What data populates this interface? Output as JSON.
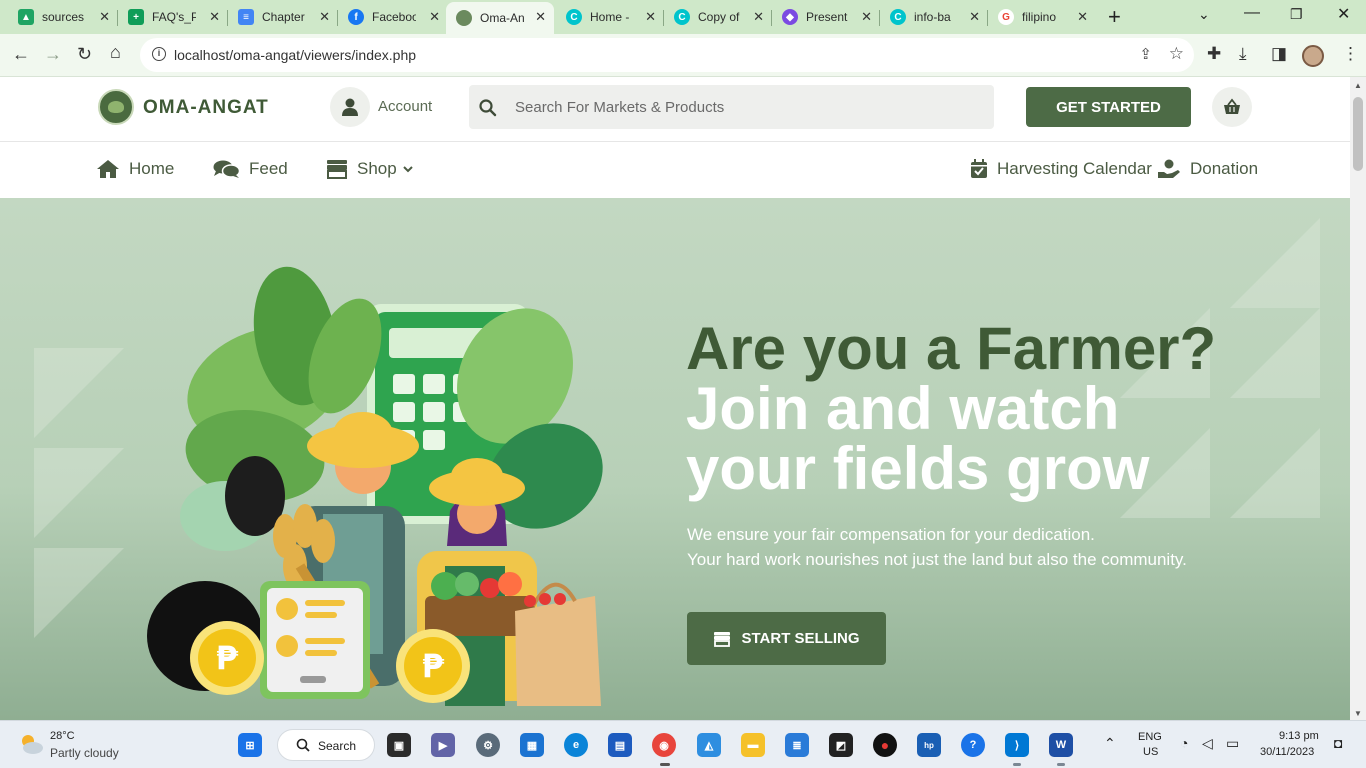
{
  "browser": {
    "tabs": [
      {
        "title": "sources",
        "icon": "google-drive-icon",
        "color": "#1fa463"
      },
      {
        "title": "FAQ's_P",
        "icon": "google-sheets-icon",
        "color": "#0f9d58"
      },
      {
        "title": "Chapter",
        "icon": "google-docs-icon",
        "color": "#4285f4"
      },
      {
        "title": "Facebook",
        "icon": "facebook-icon",
        "color": "#1877f2"
      },
      {
        "title": "Oma-An",
        "icon": "oma-angat-icon",
        "color": "#6b8a5e"
      },
      {
        "title": "Home -",
        "icon": "canva-icon",
        "color": "#00c4cc"
      },
      {
        "title": "Copy of",
        "icon": "canva-icon",
        "color": "#00c4cc"
      },
      {
        "title": "Present",
        "icon": "presentation-icon",
        "color": "#7b4ae2"
      },
      {
        "title": "info-ba",
        "icon": "canva-icon",
        "color": "#00c4cc"
      },
      {
        "title": "filipino",
        "icon": "google-icon",
        "color": "#ea4335"
      }
    ],
    "url": "localhost/oma-angat/viewers/index.php"
  },
  "header": {
    "brand": "OMA-ANGAT",
    "account_label": "Account",
    "search_placeholder": "Search For Markets & Products",
    "get_started": "GET STARTED"
  },
  "nav": {
    "home": "Home",
    "feed": "Feed",
    "shop": "Shop",
    "calendar": "Harvesting Calendar",
    "donation": "Donation"
  },
  "hero": {
    "title_line1": "Are you a Farmer?",
    "title_line2": "Join and watch",
    "title_line3": "your fields grow",
    "sub_line1": "We ensure your fair compensation for your dedication.",
    "sub_line2": "Your hard work nourishes not just the land but also the community.",
    "cta": "START SELLING",
    "coin_symbol": "₱"
  },
  "taskbar": {
    "weather_temp": "28°C",
    "weather_desc": "Partly cloudy",
    "search_label": "Search",
    "lang": "ENG",
    "region": "US",
    "time": "9:13 pm",
    "date": "30/11/2023"
  },
  "colors": {
    "brand_green": "#4d6b46",
    "title_dark": "#3f5a36",
    "hero_bg": "#b7d0b7"
  }
}
